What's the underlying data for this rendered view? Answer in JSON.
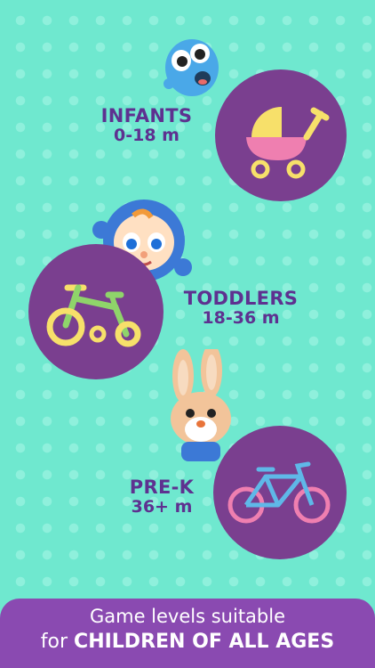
{
  "levels": [
    {
      "name": "INFANTS",
      "age": "0-18 m",
      "icon": "stroller-icon",
      "character": "blue-monster-character"
    },
    {
      "name": "TODDLERS",
      "age": "18-36 m",
      "icon": "tricycle-icon",
      "character": "blue-hood-baby-character"
    },
    {
      "name": "PRE-K",
      "age": "36+ m",
      "icon": "bicycle-icon",
      "character": "bunny-character"
    }
  ],
  "banner": {
    "line1": "Game levels suitable",
    "line2_prefix": "for",
    "line2_emphasis": "CHILDREN OF ALL AGES"
  },
  "colors": {
    "background": "#6fe8cf",
    "circle": "#7a3f8f",
    "label_text": "#5e3190",
    "banner": "#8a4ab1"
  }
}
